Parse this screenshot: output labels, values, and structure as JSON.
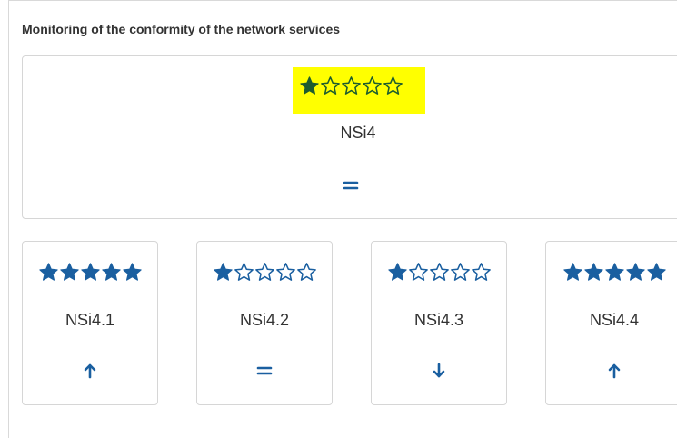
{
  "panel": {
    "title": "Monitoring of the conformity of the network services"
  },
  "main_indicator": {
    "label": "NSi4",
    "rating": 1,
    "max_rating": 5,
    "trend": "equal",
    "highlighted": true,
    "highlight_color": "#ffff00",
    "star_color": "#1d5c2f"
  },
  "sub_indicators": [
    {
      "label": "NSi4.1",
      "rating": 5,
      "max_rating": 5,
      "trend": "up"
    },
    {
      "label": "NSi4.2",
      "rating": 1,
      "max_rating": 5,
      "trend": "equal"
    },
    {
      "label": "NSi4.3",
      "rating": 1,
      "max_rating": 5,
      "trend": "down"
    },
    {
      "label": "NSi4.4",
      "rating": 5,
      "max_rating": 5,
      "trend": "up"
    }
  ],
  "colors": {
    "star_filled": "#1a5fa0",
    "star_outline": "#1a5fa0",
    "trend": "#1a5fa0",
    "card_border": "#d6d6d6"
  },
  "icons": {
    "star_filled": "star-filled-icon",
    "star_empty": "star-outline-icon",
    "trend_up": "arrow-up-icon",
    "trend_down": "arrow-down-icon",
    "trend_equal": "equals-icon"
  }
}
